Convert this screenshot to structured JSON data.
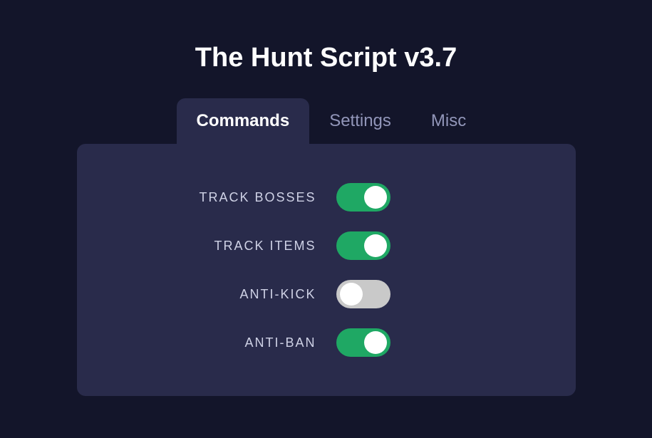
{
  "title": "The Hunt Script v3.7",
  "tabs": [
    {
      "label": "Commands",
      "active": true
    },
    {
      "label": "Settings",
      "active": false
    },
    {
      "label": "Misc",
      "active": false
    }
  ],
  "commands": [
    {
      "label": "TRACK BOSSES",
      "enabled": true
    },
    {
      "label": "TRACK ITEMS",
      "enabled": true
    },
    {
      "label": "ANTI-KICK",
      "enabled": false
    },
    {
      "label": "ANTI-BAN",
      "enabled": true
    }
  ],
  "colors": {
    "background": "#13152a",
    "panel": "#292b4b",
    "toggle_on": "#1fa864",
    "toggle_off": "#c9c9c9",
    "text_muted": "#9296b9"
  }
}
